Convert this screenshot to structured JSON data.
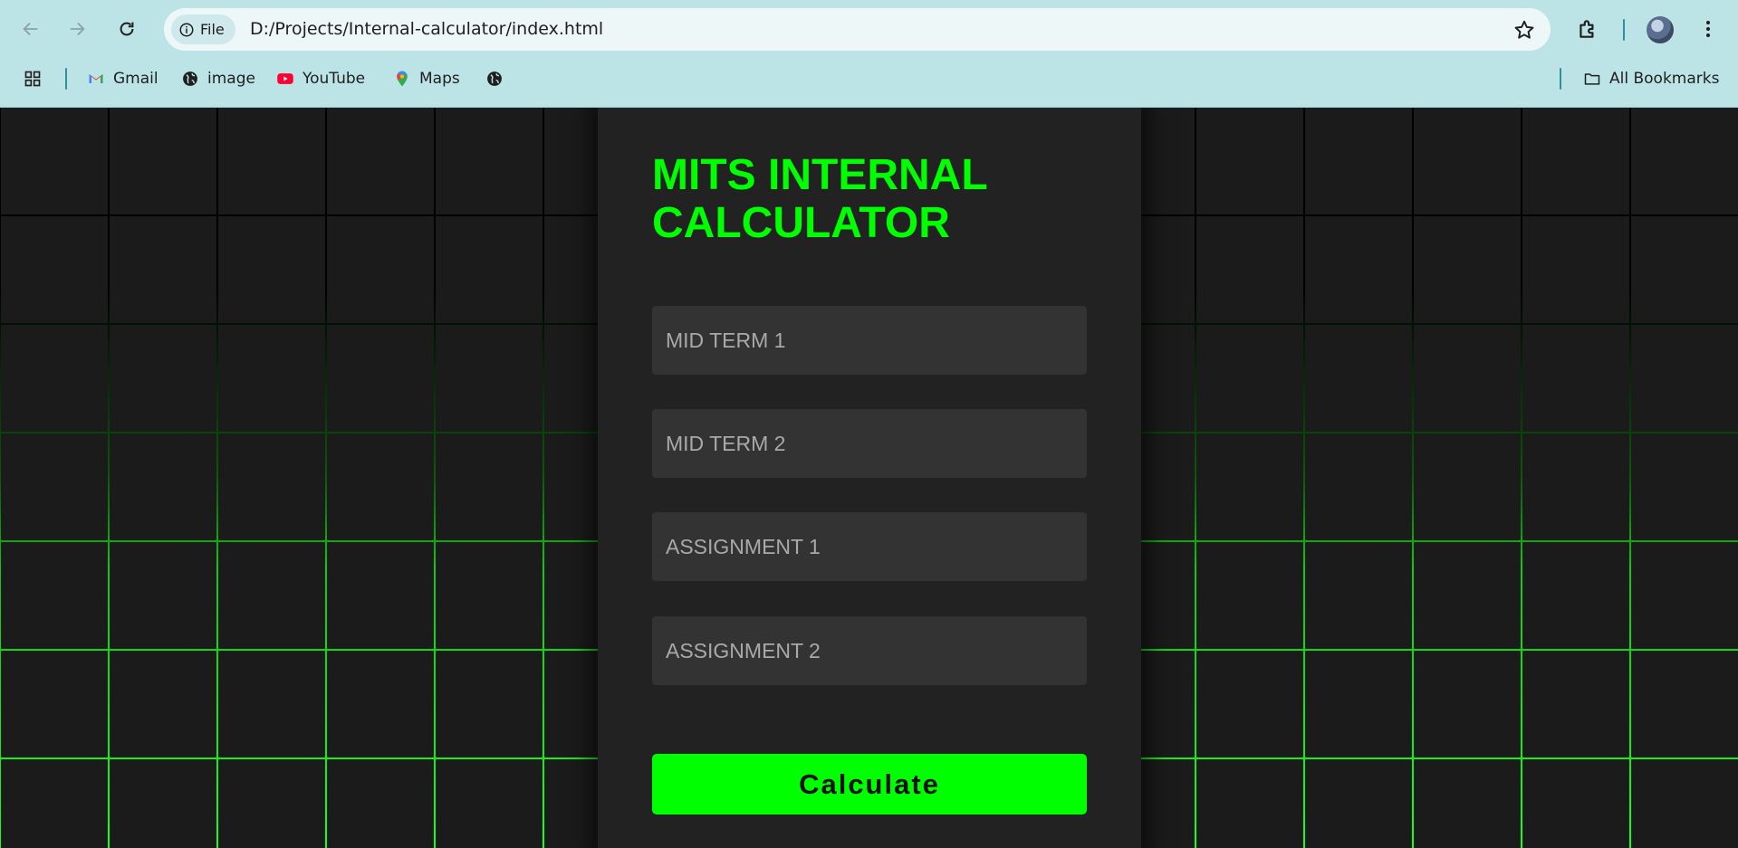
{
  "browser": {
    "site_chip_label": "File",
    "url": "D:/Projects/Internal-calculator/index.html",
    "bookmarks": [
      {
        "label": "Gmail",
        "icon": "gmail-icon"
      },
      {
        "label": "image",
        "icon": "globe-icon"
      },
      {
        "label": "YouTube",
        "icon": "youtube-icon"
      },
      {
        "label": "Maps",
        "icon": "maps-icon"
      },
      {
        "label": "",
        "icon": "globe-icon"
      }
    ],
    "all_bookmarks_label": "All Bookmarks"
  },
  "page": {
    "title": "MITS INTERNAL CALCULATOR",
    "inputs": [
      {
        "placeholder": "MID TERM 1",
        "value": ""
      },
      {
        "placeholder": "MID TERM 2",
        "value": ""
      },
      {
        "placeholder": "ASSIGNMENT 1",
        "value": ""
      },
      {
        "placeholder": "ASSIGNMENT 2",
        "value": ""
      }
    ],
    "calculate_label": "Calculate",
    "colors": {
      "accent": "#00ff00",
      "background": "#1b1b1b",
      "card": "#222222",
      "input": "#333333"
    }
  }
}
